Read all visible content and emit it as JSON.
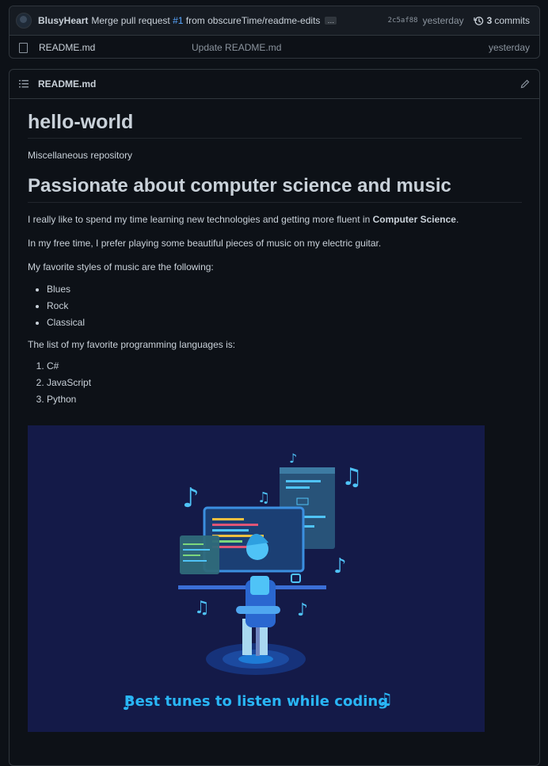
{
  "commit": {
    "author": "BlusyHeart",
    "message_prefix": "Merge pull request ",
    "pr": "#1",
    "message_suffix": " from obscureTime/readme-edits",
    "ellipsis": "…",
    "sha": "2c5af88",
    "when": "yesterday",
    "commits_count": "3",
    "commits_label": "commits"
  },
  "file": {
    "name": "README.md",
    "message": "Update README.md",
    "when": "yesterday"
  },
  "readme": {
    "filename": "README.md",
    "h1": "hello-world",
    "subtitle": "Miscellaneous repository",
    "h2": "Passionate about computer science and music",
    "p1_prefix": "I really like to spend my time learning new technologies and getting more fluent in ",
    "p1_bold": "Computer Science",
    "p1_suffix": ".",
    "p2": "In my free time, I prefer playing some beautiful pieces of music on my electric guitar.",
    "p3": "My favorite styles of music are the following:",
    "styles": [
      "Blues",
      "Rock",
      "Classical"
    ],
    "p4": "The list of my favorite programming languages is:",
    "languages": [
      "C#",
      "JavaScript",
      "Python"
    ],
    "banner_text": "Best tunes to listen while coding"
  },
  "colors": {
    "background": "#0d1117",
    "link": "#58a6ff",
    "banner_bg": "#141a48",
    "banner_text": "#29b6f6"
  }
}
